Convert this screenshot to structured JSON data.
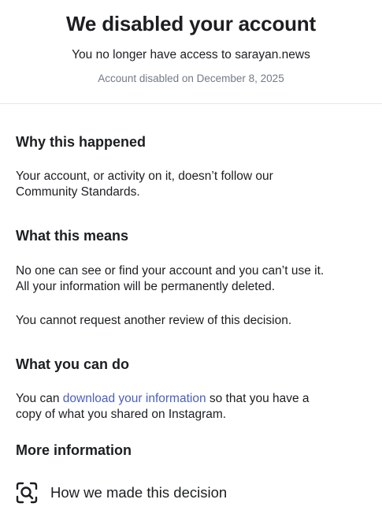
{
  "header": {
    "title": "We disabled your account",
    "subtitle": "You no longer have access to sarayan.news",
    "disabled_date": "Account disabled on December 8, 2025"
  },
  "sections": {
    "why": {
      "title": "Why this happened",
      "body_line1": "Your account, or activity on it, doesn’t follow our",
      "body_line2": "Community Standards."
    },
    "means": {
      "title": "What this means",
      "body_line1": "No one can see or find your account and you can’t use it.",
      "body_line2": "All your information will be permanently deleted.",
      "review_note": "You cannot request another review of this decision."
    },
    "can_do": {
      "title": "What you can do",
      "prefix": "You can ",
      "link_text": "download your information",
      "suffix": " so that you have a",
      "line2": "copy of what you shared on Instagram."
    },
    "more_info": {
      "title": "More information",
      "decision_label": "How we made this decision",
      "decision_icon": "search-magnify-icon"
    }
  },
  "colors": {
    "text": "#1c1e21",
    "muted": "#737b86",
    "link": "#4a5fc1",
    "divider": "#e4e6eb"
  }
}
